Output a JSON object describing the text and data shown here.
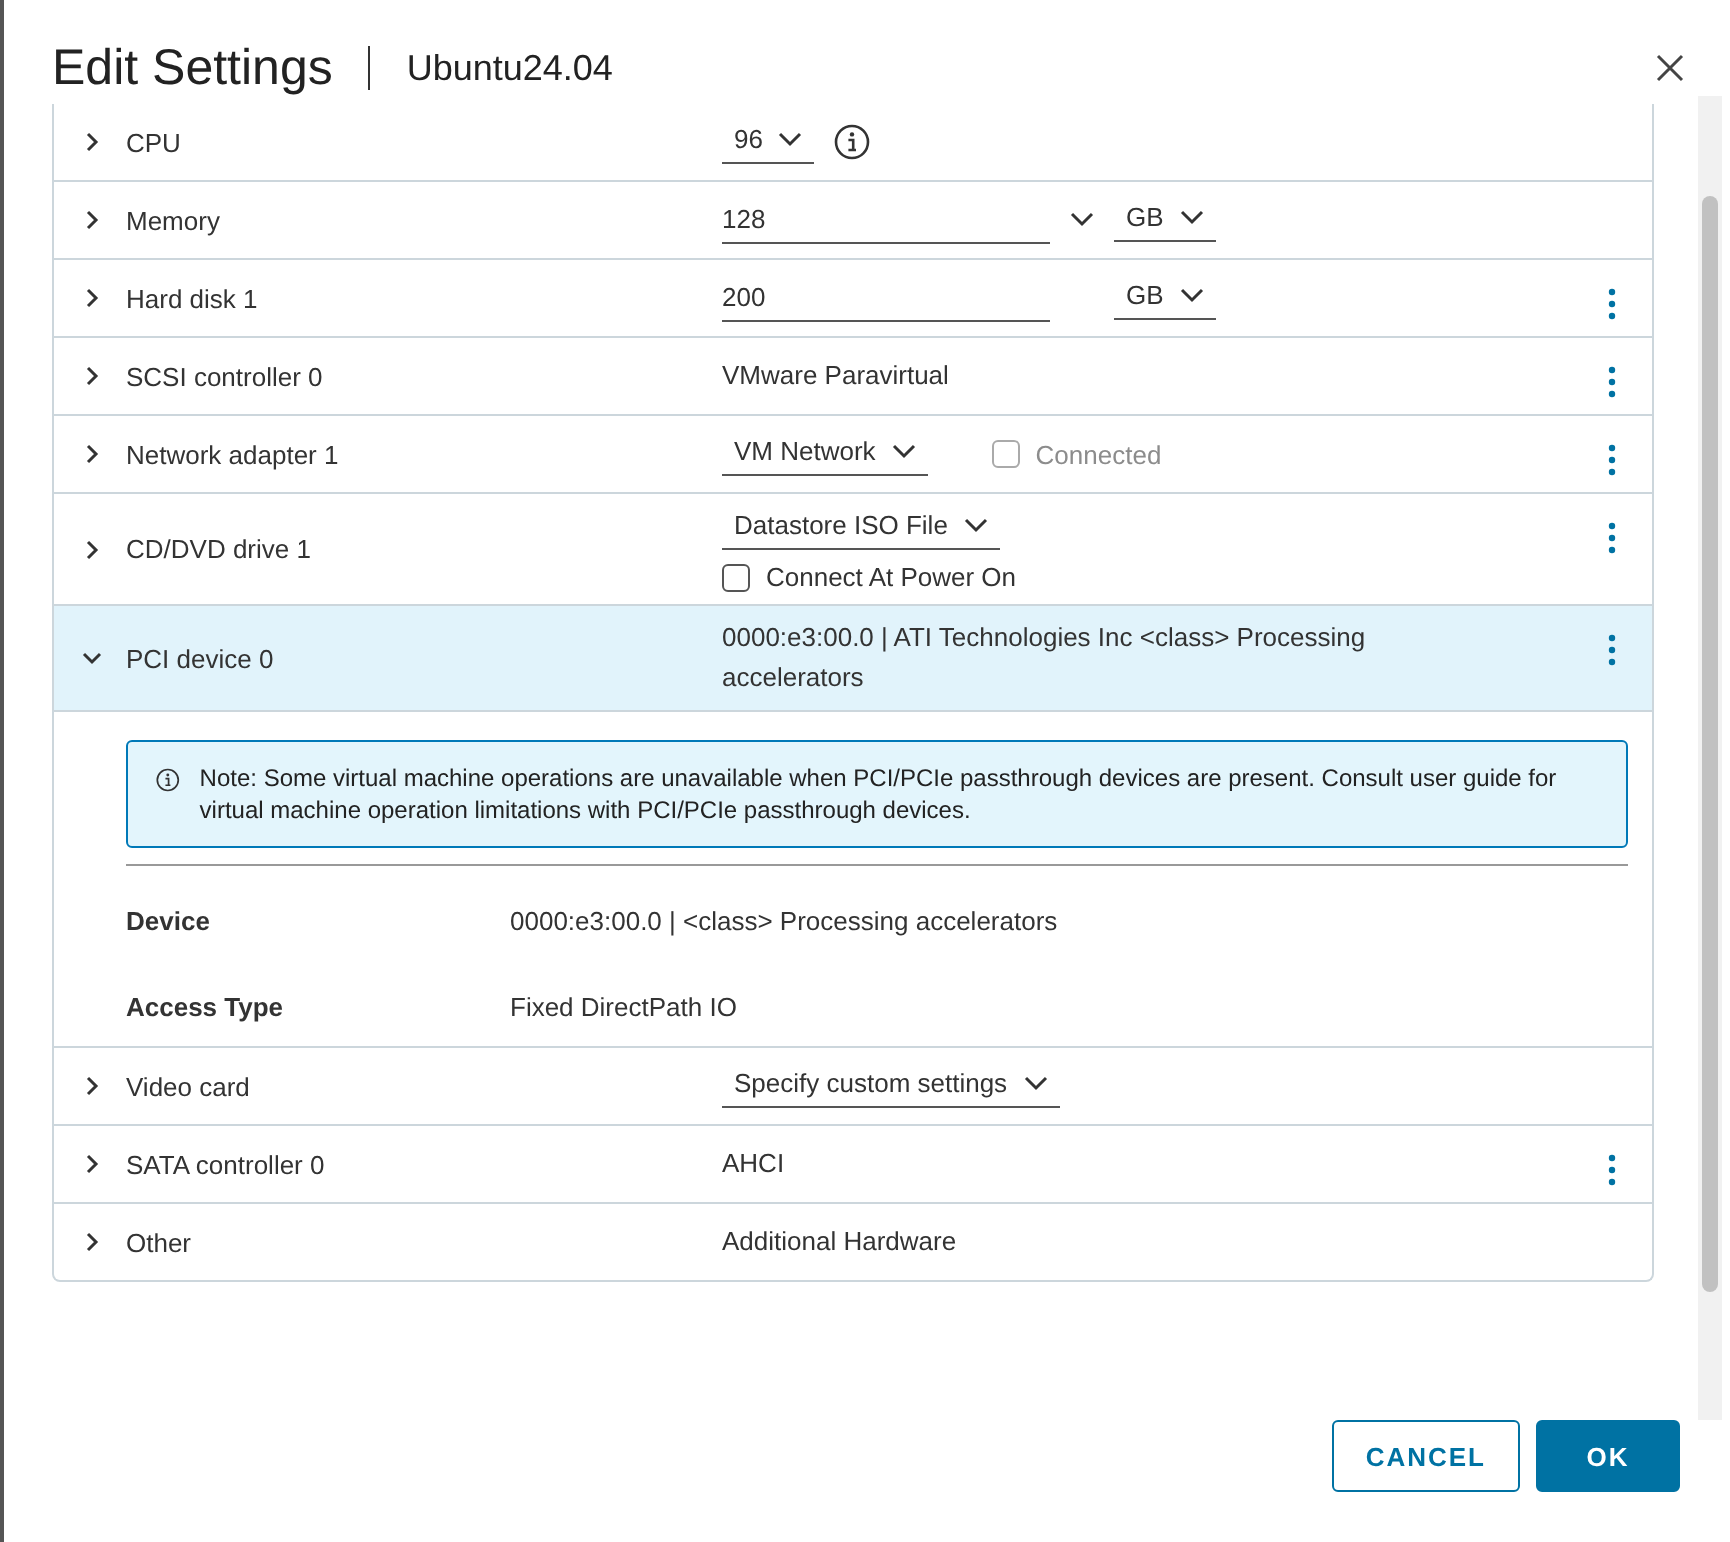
{
  "dialog": {
    "title": "Edit Settings",
    "subtitle": "Ubuntu24.04"
  },
  "rows": [
    {
      "label": "CPU",
      "kind": "dropdown",
      "expanded": false,
      "menu": false,
      "value": "96",
      "info": true
    },
    {
      "label": "Memory",
      "kind": "field",
      "expanded": false,
      "menu": false,
      "value": "128",
      "unit": "GB",
      "extra_caret": true
    },
    {
      "label": "Hard disk 1",
      "kind": "field",
      "expanded": false,
      "menu": true,
      "value": "200",
      "unit": "GB",
      "extra_caret": false
    },
    {
      "label": "SCSI controller 0",
      "kind": "text",
      "expanded": false,
      "menu": true,
      "value": "VMware Paravirtual"
    },
    {
      "label": "Network adapter 1",
      "kind": "inline",
      "expanded": false,
      "menu": true,
      "value": "VM Network",
      "checkbox": {
        "label": "Connected",
        "checked": false,
        "disabled": true
      }
    },
    {
      "label": "CD/DVD drive 1",
      "kind": "stacked",
      "expanded": false,
      "menu": true,
      "value": "Datastore ISO File",
      "checkbox": {
        "label": "Connect At Power On",
        "checked": false,
        "disabled": false
      }
    },
    {
      "label": "PCI device 0",
      "kind": "text",
      "expanded": true,
      "menu": true,
      "value": "0000:e3:00.0 | ATI Technologies Inc <class> Processing accelerators",
      "note": "Note: Some virtual machine operations are unavailable when PCI/PCIe passthrough devices are present. Consult user guide for virtual machine operation limitations with PCI/PCIe passthrough devices.",
      "details": [
        {
          "label": "Device",
          "value": "0000:e3:00.0 | <class> Processing accelerators"
        },
        {
          "label": "Access Type",
          "value": "Fixed DirectPath IO"
        }
      ]
    },
    {
      "label": "Video card",
      "kind": "dropdown",
      "expanded": false,
      "menu": false,
      "value": "Specify custom settings",
      "info": false
    },
    {
      "label": "SATA controller 0",
      "kind": "text",
      "expanded": false,
      "menu": true,
      "value": "AHCI"
    },
    {
      "label": "Other",
      "kind": "text",
      "expanded": false,
      "menu": false,
      "value": "Additional Hardware"
    }
  ],
  "buttons": [
    {
      "label": "CANCEL",
      "kind": "outline"
    },
    {
      "label": "OK",
      "kind": "primary"
    }
  ]
}
